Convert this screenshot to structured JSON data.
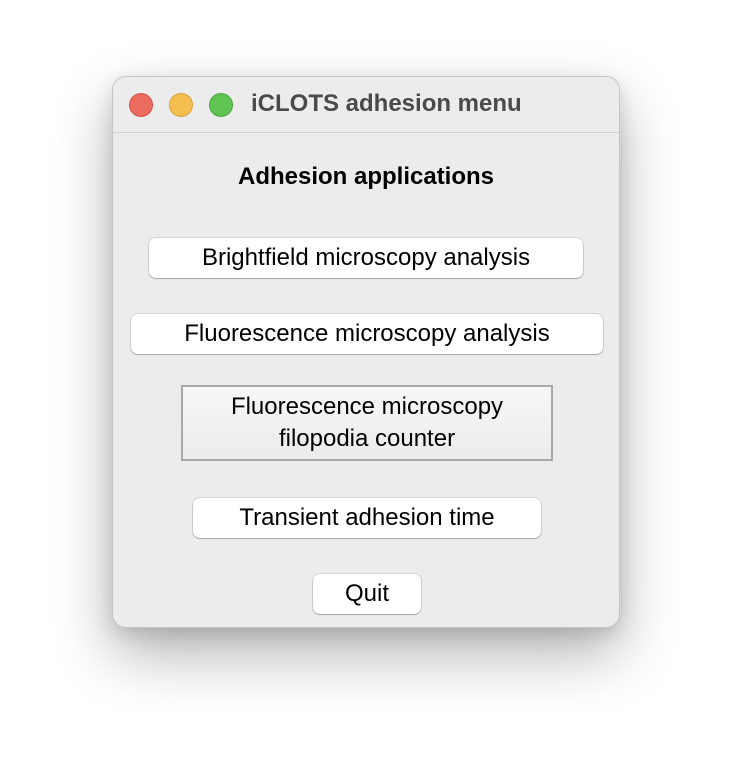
{
  "window": {
    "title": "iCLOTS adhesion menu",
    "controls": [
      "close",
      "minimize",
      "zoom"
    ]
  },
  "heading": "Adhesion applications",
  "buttons": {
    "brightfield": "Brightfield microscopy analysis",
    "fluorescence": "Fluorescence microscopy analysis",
    "filopodia_line1": "Fluorescence microscopy",
    "filopodia_line2": "filopodia counter",
    "transient": "Transient adhesion time",
    "quit": "Quit"
  }
}
